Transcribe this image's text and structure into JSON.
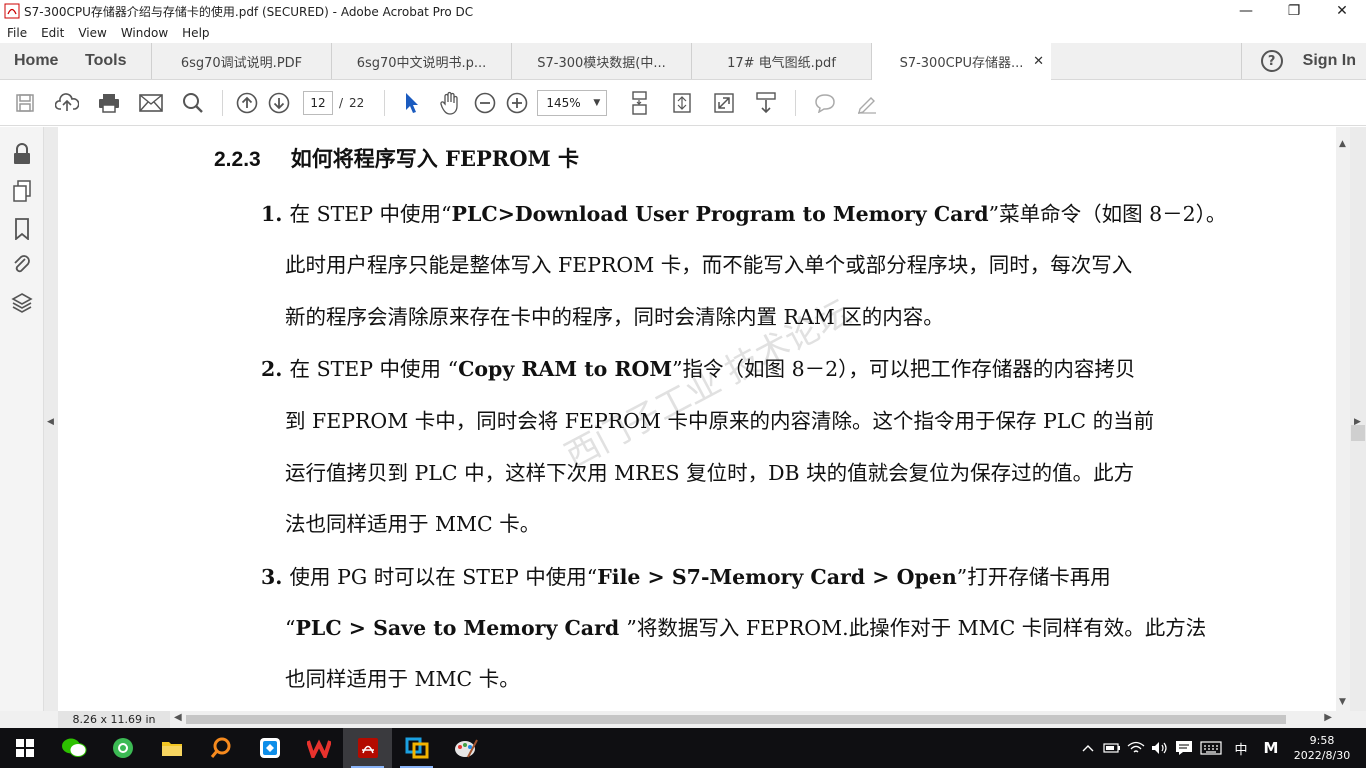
{
  "window": {
    "title": "S7-300CPU存储器介绍与存储卡的使用.pdf (SECURED) - Adobe Acrobat Pro DC",
    "minimize": "—",
    "maximize": "❐",
    "close": "✕"
  },
  "menu": [
    "File",
    "Edit",
    "View",
    "Window",
    "Help"
  ],
  "tabs": {
    "home": "Home",
    "tools": "Tools",
    "documents": [
      {
        "label": "6sg70调试说明.PDF"
      },
      {
        "label": "6sg70中文说明书.p..."
      },
      {
        "label": "S7-300模块数据(中..."
      },
      {
        "label": "17# 电气图纸.pdf"
      },
      {
        "label": "S7-300CPU存储器...",
        "active": true
      }
    ],
    "close_glyph": "✕",
    "help": "?",
    "sign_in": "Sign In"
  },
  "toolbar": {
    "current_page": "12",
    "page_separator": "/",
    "total_pages": "22",
    "zoom": "145%"
  },
  "document": {
    "heading_number": "2.2.3",
    "heading_text": "如何将程序写入 FEPROM 卡",
    "lines": [
      {
        "pre": "1. ",
        "a": "在 STEP 中使用“",
        "b": "PLC>Download User Program to Memory Card",
        "c": "”菜单命令（如图 8－2）。"
      },
      {
        "pre": "",
        "a": "此时用户程序只能是整体写入 FEPROM 卡，而不能写入单个或部分程序块，同时，每次写入",
        "b": "",
        "c": ""
      },
      {
        "pre": "",
        "a": "新的程序会清除原来存在卡中的程序，同时会清除内置 RAM  区的内容。",
        "b": "",
        "c": ""
      },
      {
        "pre": "2. ",
        "a": "在 STEP 中使用 “",
        "b": "Copy RAM to ROM",
        "c": "”指令（如图 8－2），可以把工作存储器的内容拷贝"
      },
      {
        "pre": "",
        "a": "到 FEPROM 卡中，同时会将 FEPROM 卡中原来的内容清除。这个指令用于保存 PLC 的当前",
        "b": "",
        "c": ""
      },
      {
        "pre": "",
        "a": "运行值拷贝到 PLC 中，这样下次用 MRES 复位时，DB 块的值就会复位为保存过的值。此方",
        "b": "",
        "c": ""
      },
      {
        "pre": "",
        "a": "法也同样适用于 MMC 卡。",
        "b": "",
        "c": ""
      },
      {
        "pre": "3. ",
        "a": "使用  PG  时可以在  STEP  中使用“",
        "b": "File  >  S7-Memory  Card  >  Open",
        "c": "”打开存储卡再用"
      },
      {
        "pre": "",
        "a": "“",
        "b": "PLC > Save to Memory Card ",
        "c": "”将数据写入 FEPROM.此操作对于 MMC 卡同样有效。此方法"
      },
      {
        "pre": "",
        "a": "也同样适用于 MMC 卡。",
        "b": "",
        "c": ""
      }
    ],
    "watermark": "西门子工业 技术论坛"
  },
  "status": {
    "page_size": "8.26 x 11.69 in"
  },
  "taskbar": {
    "apps": [
      "start-icon",
      "wechat-icon",
      "browser-icon",
      "file-explorer-icon",
      "search-app-icon",
      "teamviewer-icon",
      "wps-icon",
      "acrobat-icon",
      "network-app-icon",
      "paint-icon"
    ],
    "ime": "中",
    "ime2": "M",
    "time": "9:58",
    "date": "2022/8/30"
  }
}
